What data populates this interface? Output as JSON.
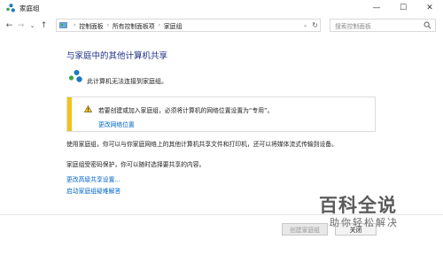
{
  "window": {
    "title": "家庭组",
    "minimize_glyph": "—",
    "maximize_glyph": "☐",
    "close_glyph": "✕"
  },
  "nav": {
    "back_glyph": "←",
    "forward_glyph": "→",
    "recent_glyph": "⌄",
    "up_glyph": "↑"
  },
  "address": {
    "crumbs": [
      "控制面板",
      "所有控制面板项",
      "家庭组"
    ],
    "separator": "›",
    "dropdown_glyph": "⌄",
    "refresh_glyph": "↻"
  },
  "search": {
    "placeholder": "搜索控制面板"
  },
  "content": {
    "title": "与家庭中的其他计算机共享",
    "status": "此计算机无法连接到家庭组。",
    "warning": {
      "text": "若要创建或加入家庭组，必须将计算机的网络位置设置为“专用”。",
      "link": "更改网络位置"
    },
    "desc1": "使用家庭组，你可以与你家庭网络上的其他计算机共享文件和打印机，还可以将媒体流式传输到设备。",
    "desc2": "家庭组受密码保护，你可以随时选择要共享的内容。",
    "link1": "更改高级共享设置...",
    "link2": "启动家庭组疑难解答"
  },
  "footer": {
    "create_label": "创建家庭组",
    "close_label": "关闭"
  },
  "watermark": {
    "line1": "百科全说",
    "line2": "助你轻松解决"
  },
  "colors": {
    "title_blue": "#1e3287",
    "link_blue": "#0066cc",
    "warning_yellow": "#f2c318",
    "homegroup_blue": "#1a78c2",
    "homegroup_green": "#3aa845"
  }
}
